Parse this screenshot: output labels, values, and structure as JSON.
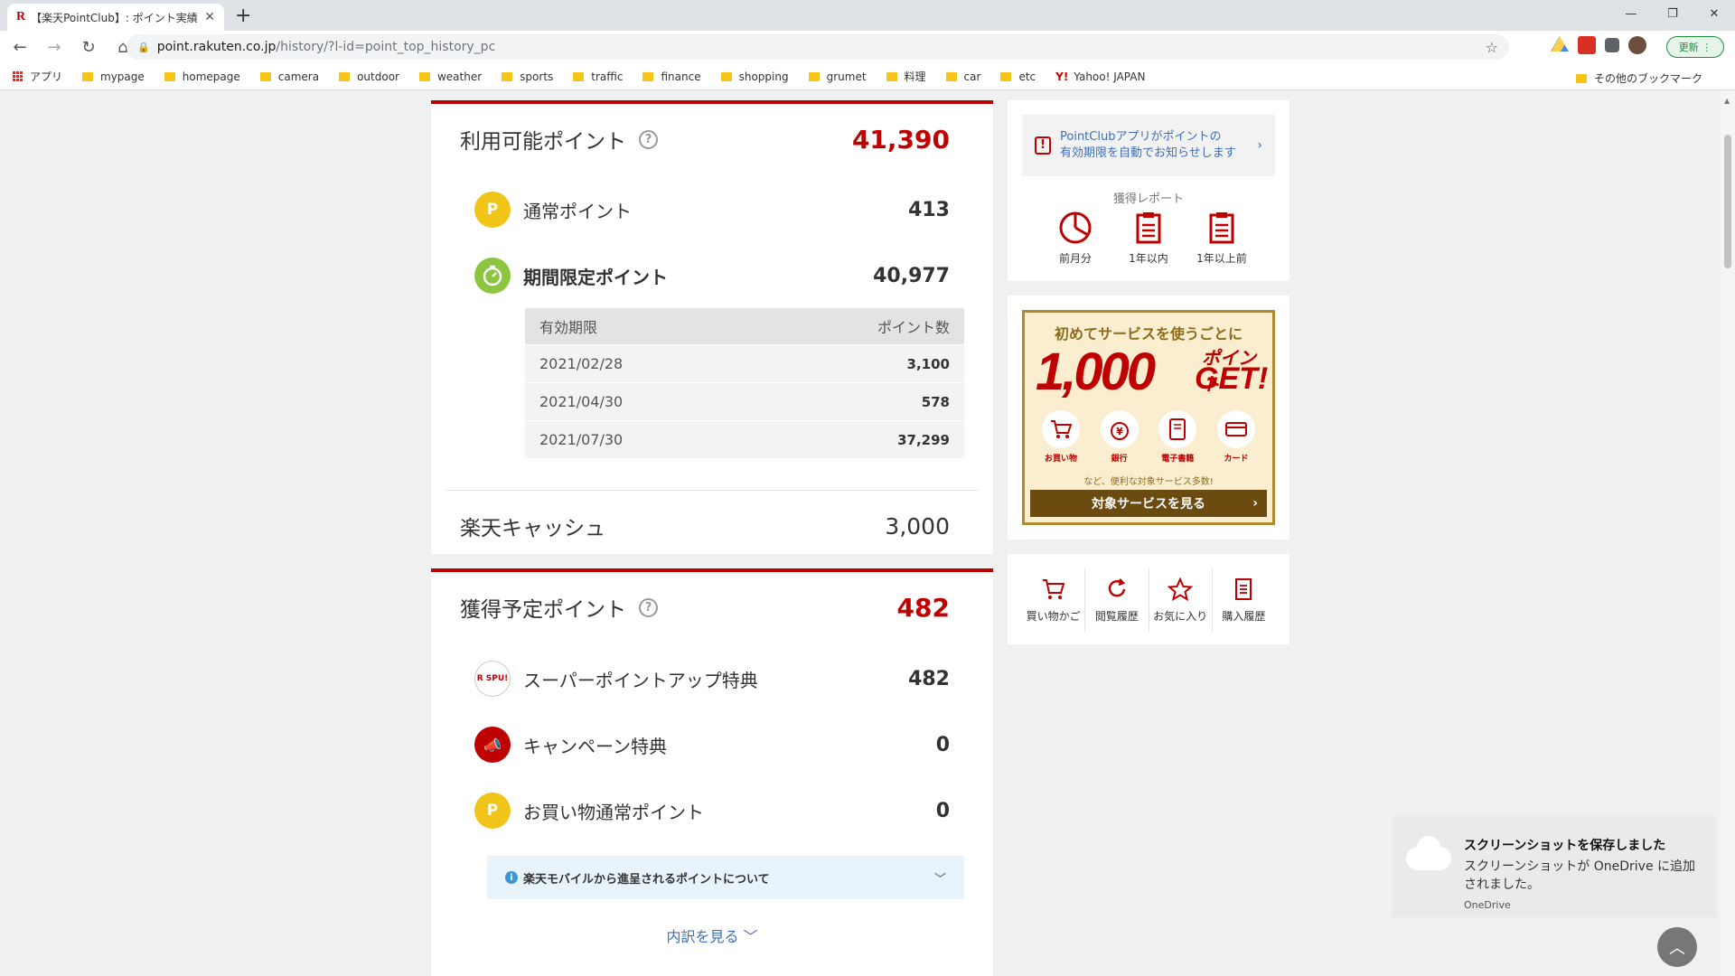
{
  "browser": {
    "tab_title": "【楽天PointClub】: ポイント実績",
    "tab_favicon": "R",
    "tab_close": "✕",
    "new_tab": "+",
    "url_host": "point.rakuten.co.jp",
    "url_path": "/history/?l-id=point_top_history_pc",
    "update_label": "更新",
    "win_min": "—",
    "win_restore": "❐",
    "win_close": "✕"
  },
  "bookmarks": {
    "apps": "アプリ",
    "items": [
      "mypage",
      "homepage",
      "camera",
      "outdoor",
      "weather",
      "sports",
      "traffic",
      "finance",
      "shopping",
      "grumet",
      "料理",
      "car",
      "etc"
    ],
    "yahoo": "Yahoo! JAPAN",
    "other": "その他のブックマーク"
  },
  "available": {
    "title": "利用可能ポイント",
    "help": "?",
    "total": "41,390",
    "normal_label": "通常ポイント",
    "normal_icon_letter": "P",
    "normal_value": "413",
    "limited_label": "期間限定ポイント",
    "limited_value": "40,977",
    "table_head_date": "有効期限",
    "table_head_points": "ポイント数",
    "expirations": [
      {
        "date": "2021/02/28",
        "points": "3,100"
      },
      {
        "date": "2021/04/30",
        "points": "578"
      },
      {
        "date": "2021/07/30",
        "points": "37,299"
      }
    ],
    "cash_label": "楽天キャッシュ",
    "cash_value": "3,000"
  },
  "pending": {
    "title": "獲得予定ポイント",
    "help": "?",
    "total": "482",
    "items": [
      {
        "label": "スーパーポイントアップ特典",
        "value": "482",
        "icon": "R SPU!"
      },
      {
        "label": "キャンペーン特典",
        "value": "0"
      },
      {
        "label": "お買い物通常ポイント",
        "value": "0",
        "icon": "P"
      }
    ],
    "info_text": "楽天モバイルから進呈されるポイントについて",
    "info_icon": "i",
    "detail_link": "内訳を見る ﹀"
  },
  "side": {
    "notice_line1": "PointClubアプリがポイントの",
    "notice_line2": "有効期限を自動でお知らせします",
    "notice_alert": "!",
    "report_title": "獲得レポート",
    "reports": [
      "前月分",
      "1年以内",
      "1年以上前"
    ],
    "banner_top": "初めてサービスを使うごとに",
    "banner_big": "1,000",
    "banner_pt": "ポイント",
    "banner_get": "GET!",
    "banner_services": [
      "お買い物",
      "銀行",
      "電子書籍",
      "カード"
    ],
    "banner_note": "など、便利な対象サービス多数!",
    "banner_button": "対象サービスを見る",
    "quick_links": [
      "買い物かご",
      "閲覧履歴",
      "お気に入り",
      "購入履歴"
    ]
  },
  "toast": {
    "title": "スクリーンショットを保存しました",
    "body": "スクリーンショットが OneDrive に追加されました。",
    "app": "OneDrive"
  },
  "colors": {
    "brand_red": "#bf0000",
    "link_blue": "#3d6fb6",
    "point_yellow": "#f0c419",
    "limited_green": "#8cc63f"
  }
}
